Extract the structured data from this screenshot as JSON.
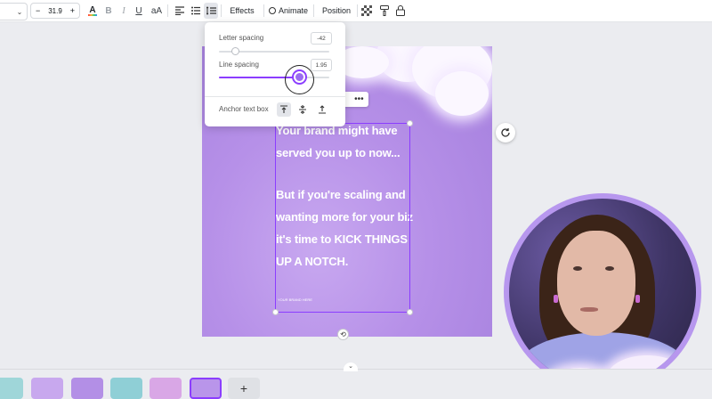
{
  "toolbar": {
    "font_size": "31.9",
    "decrease": "−",
    "increase": "+",
    "text_color": "A",
    "bold": "B",
    "italic": "I",
    "underline": "U",
    "case": "aA",
    "effects": "Effects",
    "animate": "Animate",
    "position": "Position"
  },
  "spacing_popover": {
    "letter_spacing_label": "Letter spacing",
    "letter_spacing_value": "-42",
    "letter_spacing_fraction": 0.15,
    "line_spacing_label": "Line spacing",
    "line_spacing_value": "1.95",
    "line_spacing_fraction": 0.73,
    "anchor_label": "Anchor text box"
  },
  "design": {
    "paragraph_1": "Your brand might have served you up to now...",
    "paragraph_2": "But if you're scaling and wanting more for your biz it's time to KICK THINGS UP A NOTCH.",
    "small_text": "YOUR BRAND HERE"
  },
  "colors": {
    "accent": "#8b3dff",
    "design_bg": "#b690e8",
    "webcam_border": "#b797ee"
  },
  "icons": {
    "chevron": "chevron-down-icon",
    "rotate": "rotate-icon",
    "refresh": "refresh-icon",
    "more": "more-icon",
    "add": "plus-icon"
  }
}
